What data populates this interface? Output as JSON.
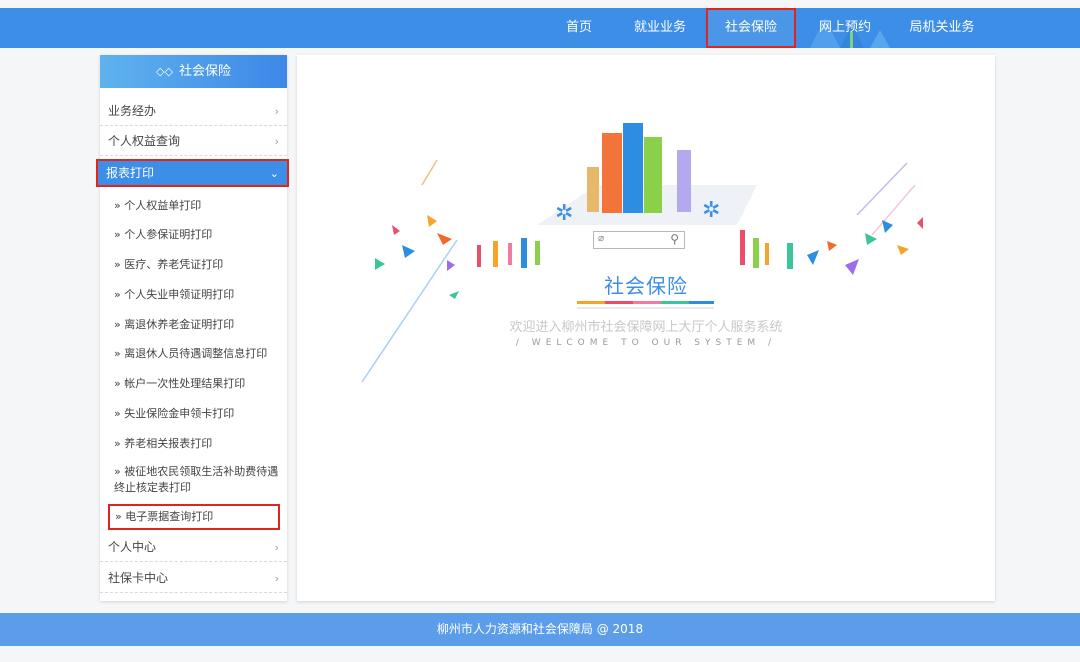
{
  "nav": {
    "items": [
      {
        "label": "首页"
      },
      {
        "label": "就业业务"
      },
      {
        "label": "社会保险"
      },
      {
        "label": "网上预约"
      },
      {
        "label": "局机关业务"
      }
    ]
  },
  "sidebar": {
    "header": "社会保险",
    "rows": [
      {
        "label": "业务经办"
      },
      {
        "label": "个人权益查询"
      },
      {
        "label": "报表打印"
      },
      {
        "label": "个人中心"
      },
      {
        "label": "社保卡中心"
      }
    ],
    "sub_items": [
      {
        "label": "» 个人权益单打印"
      },
      {
        "label": "» 个人参保证明打印"
      },
      {
        "label": "» 医疗、养老凭证打印"
      },
      {
        "label": "» 个人失业申领证明打印"
      },
      {
        "label": "» 离退休养老金证明打印"
      },
      {
        "label": "» 离退休人员待遇调整信息打印"
      },
      {
        "label": "» 帐户一次性处理结果打印"
      },
      {
        "label": "» 失业保险金申领卡打印"
      },
      {
        "label": "» 养老相关报表打印"
      },
      {
        "label": "» 被征地农民领取生活补助费待遇终止核定表打印"
      },
      {
        "label": "» 电子票据查询打印"
      }
    ]
  },
  "main": {
    "title": "社会保险",
    "welcome": "欢迎进入柳州市社会保障网上大厅个人服务系统",
    "welcome_en": "/ WELCOME TO OUR SYSTEM /"
  },
  "footer": {
    "text": "柳州市人力资源和社会保障局 @ 2018"
  },
  "colors": {
    "primary": "#3d8ee6",
    "highlight_border": "#e0251f",
    "footer": "#5b9de8"
  }
}
